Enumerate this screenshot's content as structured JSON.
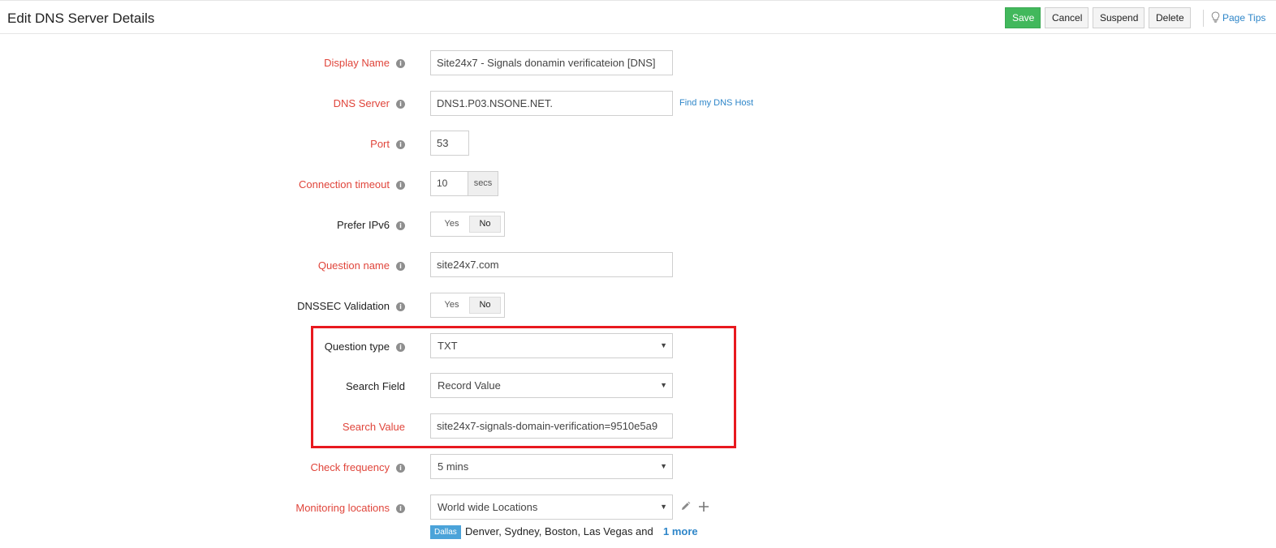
{
  "header": {
    "title": "Edit DNS Server Details",
    "buttons": {
      "save": "Save",
      "cancel": "Cancel",
      "suspend": "Suspend",
      "delete": "Delete"
    },
    "page_tips": "Page Tips"
  },
  "form": {
    "display_name": {
      "label": "Display Name",
      "value": "Site24x7 - Signals donamin verificateion [DNS]"
    },
    "dns_server": {
      "label": "DNS Server",
      "value": "DNS1.P03.NSONE.NET.",
      "link": "Find my DNS Host"
    },
    "port": {
      "label": "Port",
      "value": "53"
    },
    "connection_timeout": {
      "label": "Connection timeout",
      "value": "10",
      "unit": "secs"
    },
    "prefer_ipv6": {
      "label": "Prefer IPv6",
      "yes": "Yes",
      "no": "No",
      "selected": "No"
    },
    "question_name": {
      "label": "Question name",
      "value": "site24x7.com"
    },
    "dnssec_validation": {
      "label": "DNSSEC Validation",
      "yes": "Yes",
      "no": "No",
      "selected": "No"
    },
    "question_type": {
      "label": "Question type",
      "value": "TXT"
    },
    "search_field": {
      "label": "Search Field",
      "value": "Record Value"
    },
    "search_value": {
      "label": "Search Value",
      "value": "site24x7-signals-domain-verification=9510e5a9"
    },
    "check_frequency": {
      "label": "Check frequency",
      "value": "5 mins"
    },
    "monitoring_locations": {
      "label": "Monitoring locations",
      "value": "World wide Locations",
      "tag": "Dallas",
      "list": "Denver, Sydney, Boston, Las Vegas and",
      "more": "1 more"
    }
  },
  "colors": {
    "required_label": "#e0453b",
    "save_button": "#42b85c",
    "link": "#2e86c9",
    "highlight": "#e8191f",
    "location_tag": "#4ba3d9"
  },
  "icons": {
    "info": "info-circle-icon",
    "caret": "caret-down-icon",
    "edit": "pencil-icon",
    "add": "plus-icon",
    "tips": "lightbulb-icon"
  }
}
